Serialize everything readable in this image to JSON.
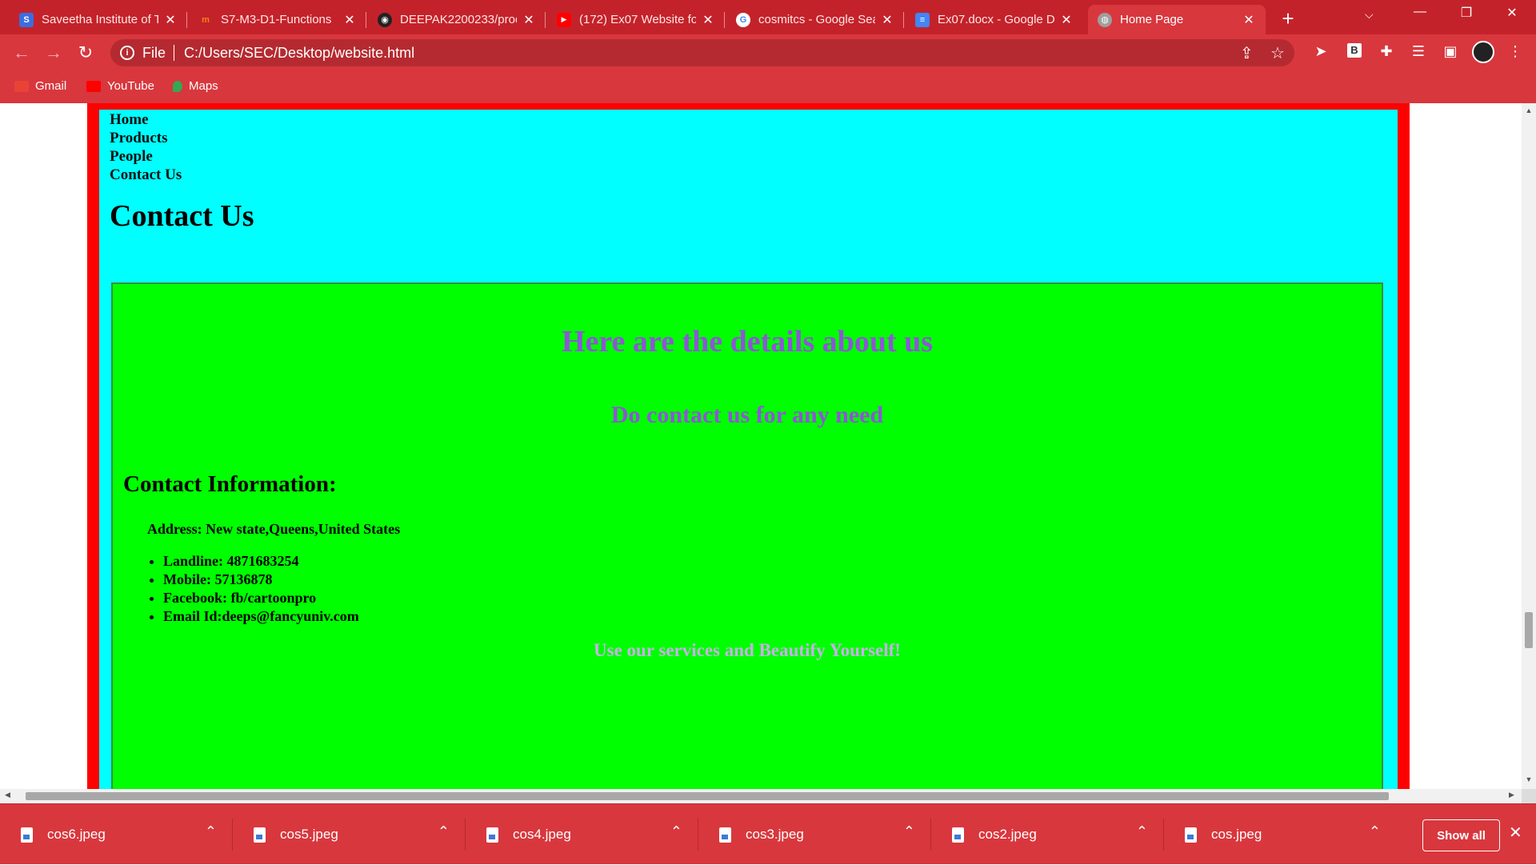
{
  "browser": {
    "tabs": [
      {
        "title": "Saveetha Institute of T",
        "favicon": "saveetha-icon",
        "favicon_letter": "S",
        "favicon_color": "#3b6de0",
        "active": false
      },
      {
        "title": "S7-M3-D1-Functions",
        "favicon": "moodle-icon",
        "favicon_letter": "m",
        "favicon_color": "#f98012",
        "active": false
      },
      {
        "title": "DEEPAK2200233/prod",
        "favicon": "github-icon",
        "favicon_letter": "◉",
        "favicon_color": "#222222",
        "active": false
      },
      {
        "title": "(172) Ex07 Website fo",
        "favicon": "youtube-icon",
        "favicon_letter": "▶",
        "favicon_color": "#ff0000",
        "active": false
      },
      {
        "title": "cosmitcs - Google Sea",
        "favicon": "google-icon",
        "favicon_letter": "G",
        "favicon_color": "#ffffff",
        "active": false
      },
      {
        "title": "Ex07.docx - Google D",
        "favicon": "google-docs-icon",
        "favicon_letter": "≡",
        "favicon_color": "#4285f4",
        "active": false
      },
      {
        "title": "Home Page",
        "favicon": "globe-icon",
        "favicon_letter": "◍",
        "favicon_color": "#9e9e9e",
        "active": true
      }
    ],
    "address": {
      "scheme_label": "File",
      "url": "C:/Users/SEC/Desktop/website.html"
    },
    "bookmarks": [
      {
        "label": "Gmail",
        "icon": "gmail-icon",
        "color": "#ea4335"
      },
      {
        "label": "YouTube",
        "icon": "youtube-icon",
        "color": "#ff0000"
      },
      {
        "label": "Maps",
        "icon": "maps-icon",
        "color": "#34a853"
      }
    ],
    "theme_color": "#d8373d"
  },
  "page": {
    "nav": [
      "Home",
      "Products",
      "People",
      "Contact Us"
    ],
    "heading": "Contact Us",
    "details_title": "Here are the details about us",
    "details_subtitle": "Do contact us for any need",
    "contact_heading": "Contact Information:",
    "address": "Address: New state,Queens,United States",
    "contacts": [
      "Landline: 4871683254",
      "Mobile: 57136878",
      "Facebook: fb/cartoonpro",
      "Email Id:deeps@fancyuniv.com"
    ],
    "footer_text": "Use our services and Beautify Yourself!",
    "colors": {
      "outer_border": "#ff0000",
      "header_bg": "#00ffff",
      "content_bg": "#00ff00",
      "title_color": "#8e55d6"
    }
  },
  "downloads": {
    "files": [
      "cos6.jpeg",
      "cos5.jpeg",
      "cos4.jpeg",
      "cos3.jpeg",
      "cos2.jpeg",
      "cos.jpeg"
    ],
    "show_all_label": "Show all"
  }
}
